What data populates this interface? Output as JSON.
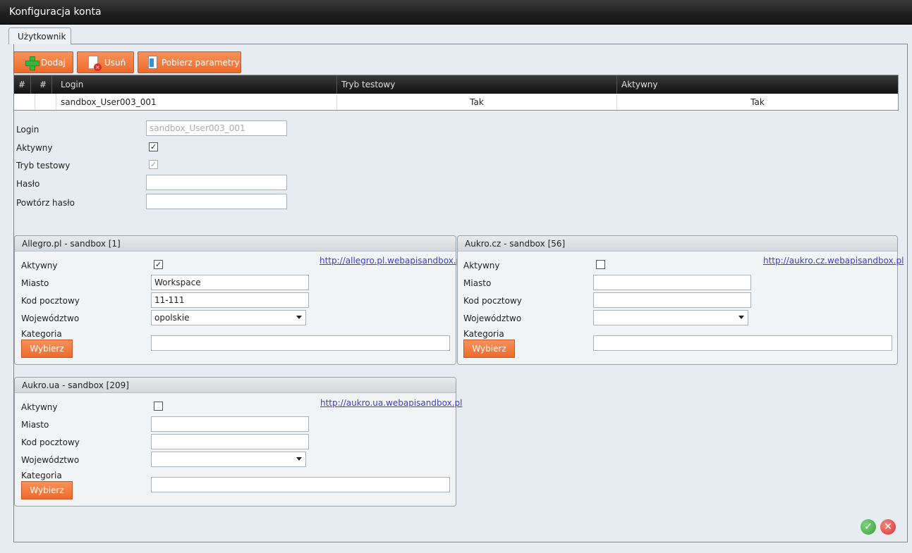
{
  "window": {
    "title": "Konfiguracja konta"
  },
  "tabs": [
    {
      "label": "Użytkownik"
    }
  ],
  "toolbar": {
    "add": "Dodaj",
    "remove": "Usuń",
    "fetch": "Pobierz parametry"
  },
  "table": {
    "columns": [
      "#",
      "#",
      "Login",
      "Tryb testowy",
      "Aktywny"
    ],
    "rows": [
      {
        "c1": "",
        "c2": "",
        "login": "sandbox_User003_001",
        "test": "Tak",
        "active": "Tak"
      }
    ]
  },
  "form": {
    "login_label": "Login",
    "login_value": "sandbox_User003_001",
    "active_label": "Aktywny",
    "active_checked": true,
    "test_label": "Tryb testowy",
    "test_checked": true,
    "password_label": "Hasło",
    "password_value": "",
    "repeat_label": "Powtórz hasło",
    "repeat_value": ""
  },
  "sites": [
    {
      "title": "Allegro.pl - sandbox [1]",
      "link": "http://allegro.pl.webapisandbox.pl",
      "active_label": "Aktywny",
      "active_checked": true,
      "city_label": "Miasto",
      "city_value": "Workspace",
      "zip_label": "Kod pocztowy",
      "zip_value": "11-111",
      "region_label": "Województwo",
      "region_value": "opolskie",
      "category_label": "Kategoria",
      "category_value": "",
      "choose_label": "Wybierz"
    },
    {
      "title": "Aukro.cz - sandbox [56]",
      "link": "http://aukro.cz.webapisandbox.pl",
      "active_label": "Aktywny",
      "active_checked": false,
      "city_label": "Miasto",
      "city_value": "",
      "zip_label": "Kod pocztowy",
      "zip_value": "",
      "region_label": "Województwo",
      "region_value": "",
      "category_label": "Kategoria",
      "category_value": "",
      "choose_label": "Wybierz"
    },
    {
      "title": "Aukro.ua - sandbox [209]",
      "link": "http://aukro.ua.webapisandbox.pl",
      "active_label": "Aktywny",
      "active_checked": false,
      "city_label": "Miasto",
      "city_value": "",
      "zip_label": "Kod pocztowy",
      "zip_value": "",
      "region_label": "Województwo",
      "region_value": "",
      "category_label": "Kategoria",
      "category_value": "",
      "choose_label": "Wybierz"
    }
  ],
  "footer": {
    "ok_icon": "check-icon",
    "cancel_icon": "close-icon",
    "ok_color": "#3aa13a",
    "cancel_color": "#d9302c"
  }
}
